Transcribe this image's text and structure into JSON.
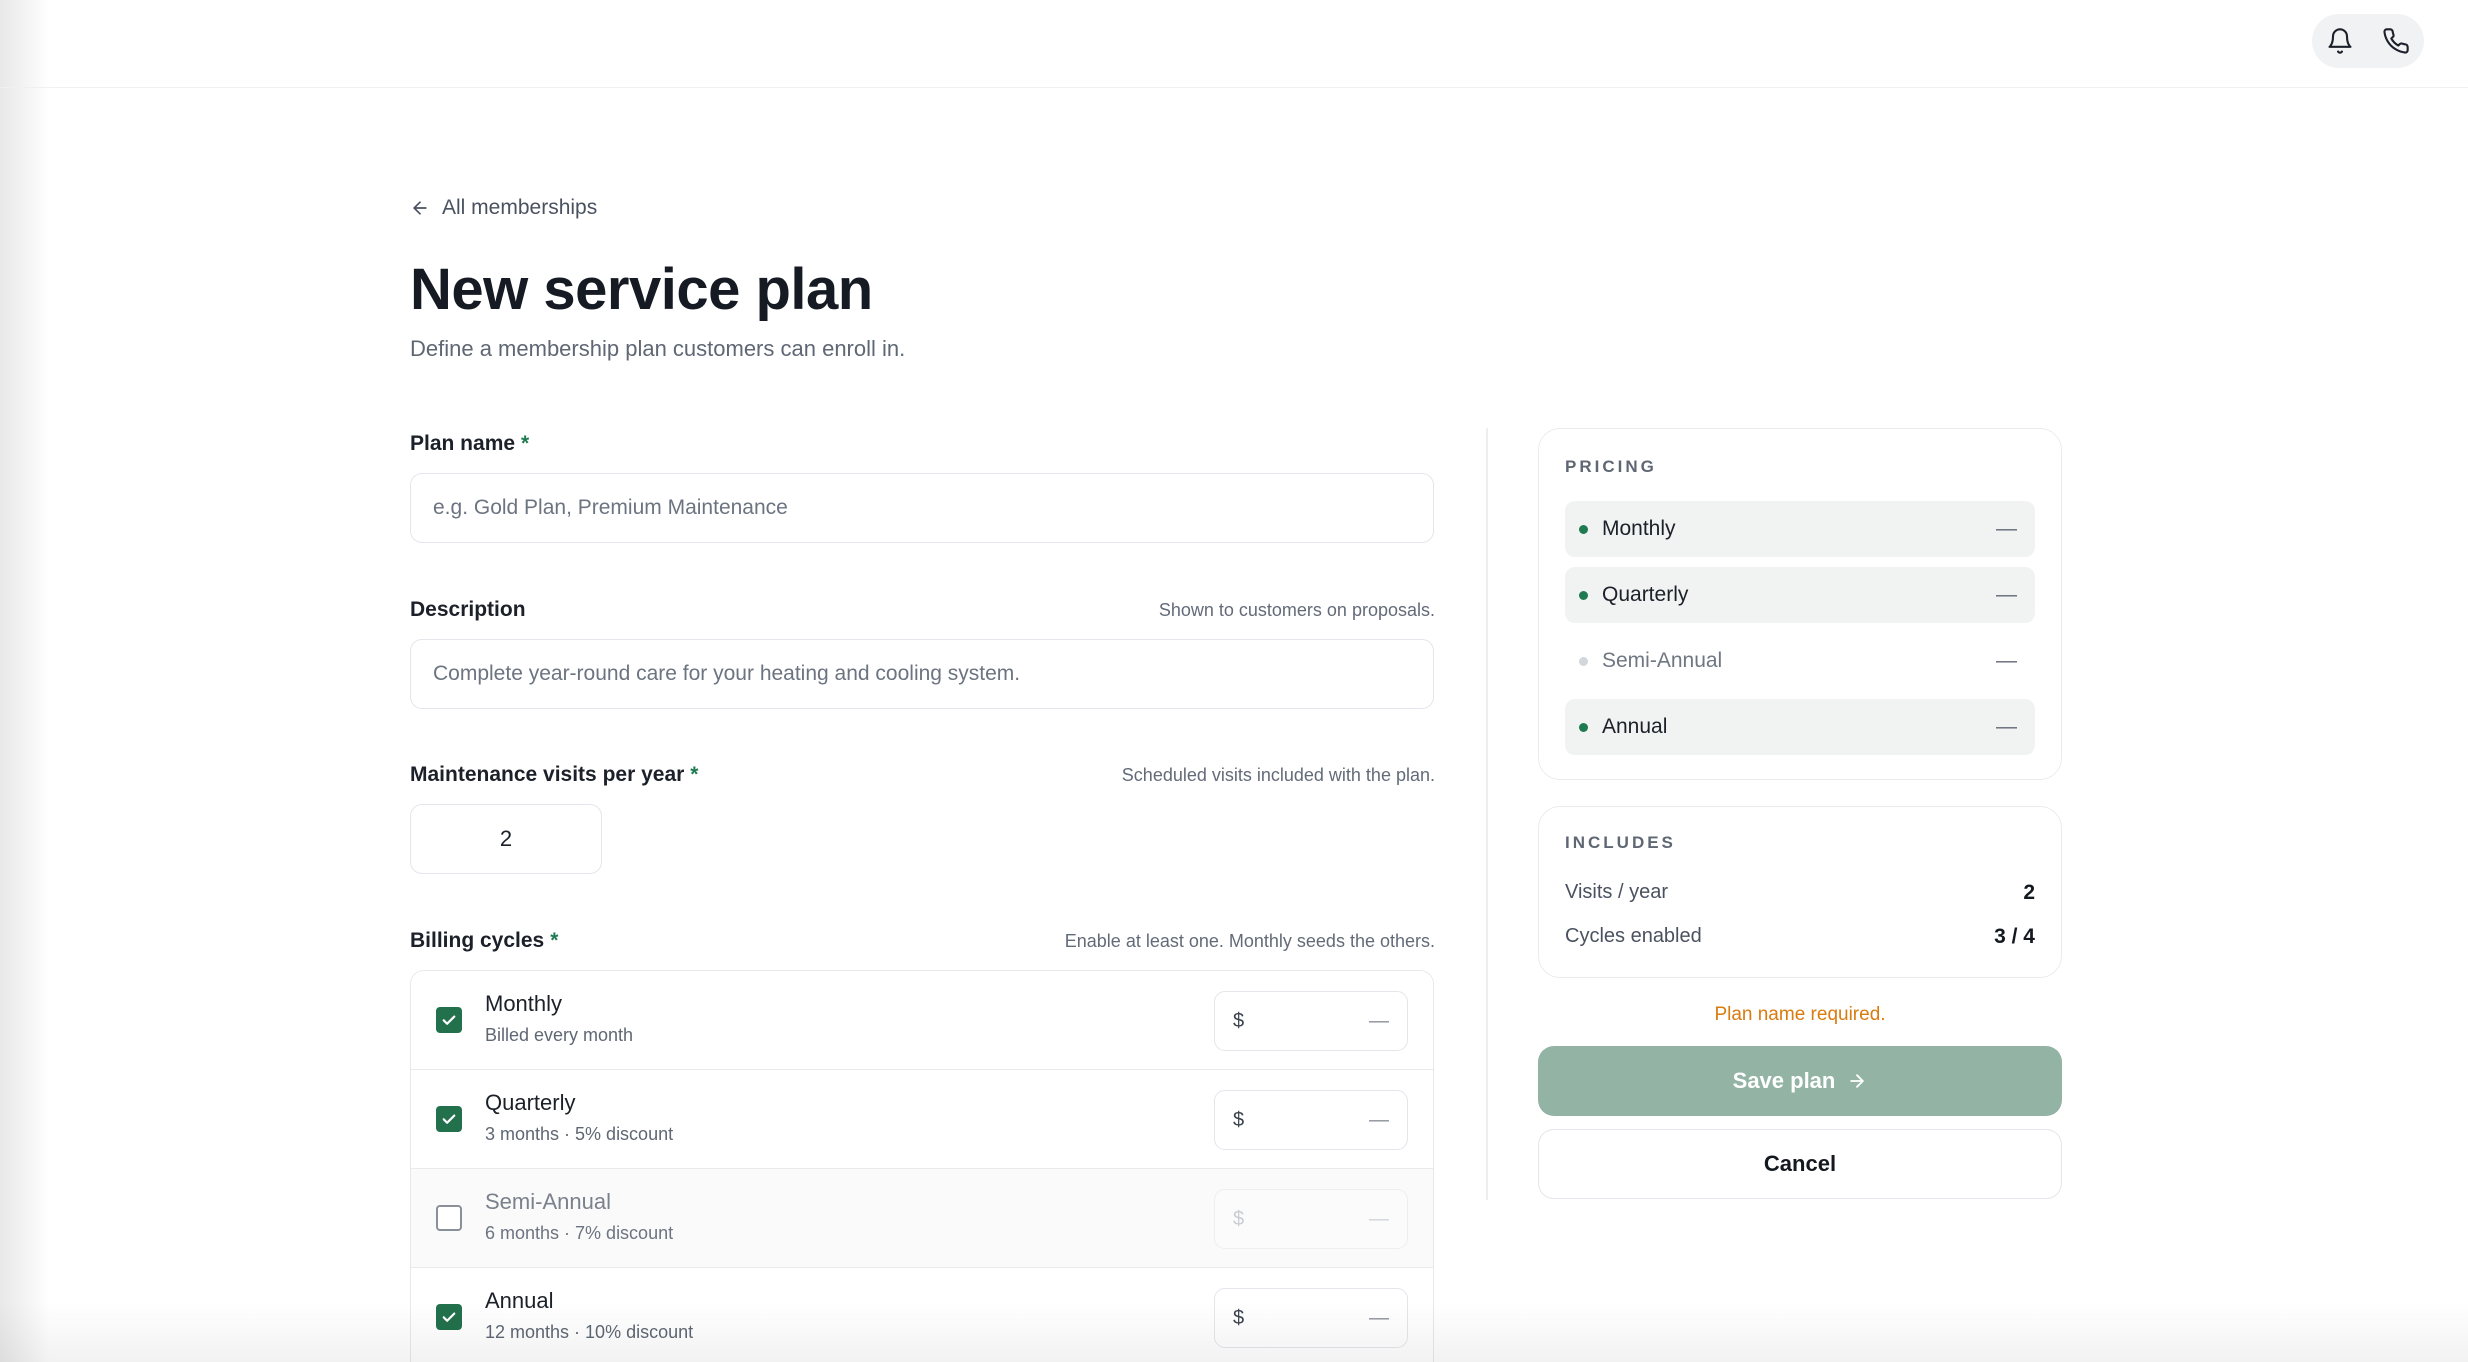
{
  "header": {
    "actions": [
      {
        "icon": "bell-icon"
      },
      {
        "icon": "phone-icon"
      }
    ]
  },
  "nav": {
    "back_label": "All memberships",
    "back_icon": "arrow-left-icon"
  },
  "page": {
    "title": "New service plan",
    "subtitle": "Define a membership plan customers can enroll in."
  },
  "form": {
    "plan_name": {
      "label": "Plan name",
      "required_mark": "*",
      "value": "",
      "placeholder": "e.g. Gold Plan, Premium Maintenance"
    },
    "description": {
      "label": "Description",
      "hint": "Shown to customers on proposals.",
      "value": "",
      "placeholder": "Complete year-round care for your heating and cooling system."
    },
    "visits": {
      "label": "Maintenance visits per year",
      "required_mark": "*",
      "hint": "Scheduled visits included with the plan.",
      "value": "2"
    },
    "billing": {
      "label": "Billing cycles",
      "required_mark": "*",
      "hint": "Enable at least one. Monthly seeds the others.",
      "cycles": [
        {
          "name": "Monthly",
          "sub": "Billed every month",
          "enabled": true,
          "currency": "$",
          "price": "—"
        },
        {
          "name": "Quarterly",
          "sub": "3 months · 5% discount",
          "enabled": true,
          "currency": "$",
          "price": "—"
        },
        {
          "name": "Semi-Annual",
          "sub": "6 months · 7% discount",
          "enabled": false,
          "currency": "$",
          "price": "—"
        },
        {
          "name": "Annual",
          "sub": "12 months · 10% discount",
          "enabled": true,
          "currency": "$",
          "price": "—"
        }
      ]
    }
  },
  "sidebar": {
    "pricing": {
      "heading": "PRICING",
      "rows": [
        {
          "name": "Monthly",
          "value": "—",
          "enabled": true
        },
        {
          "name": "Quarterly",
          "value": "—",
          "enabled": true
        },
        {
          "name": "Semi-Annual",
          "value": "—",
          "enabled": false
        },
        {
          "name": "Annual",
          "value": "—",
          "enabled": true
        }
      ]
    },
    "includes": {
      "heading": "INCLUDES",
      "rows": [
        {
          "label": "Visits / year",
          "value": "2"
        },
        {
          "label": "Cycles enabled",
          "value": "3 / 4"
        }
      ]
    },
    "warning": "Plan name required.",
    "save_label": "Save plan",
    "cancel_label": "Cancel"
  },
  "colors": {
    "accent": "#22704c",
    "save_disabled": "#93b4a4",
    "warning": "#d97b0e"
  }
}
